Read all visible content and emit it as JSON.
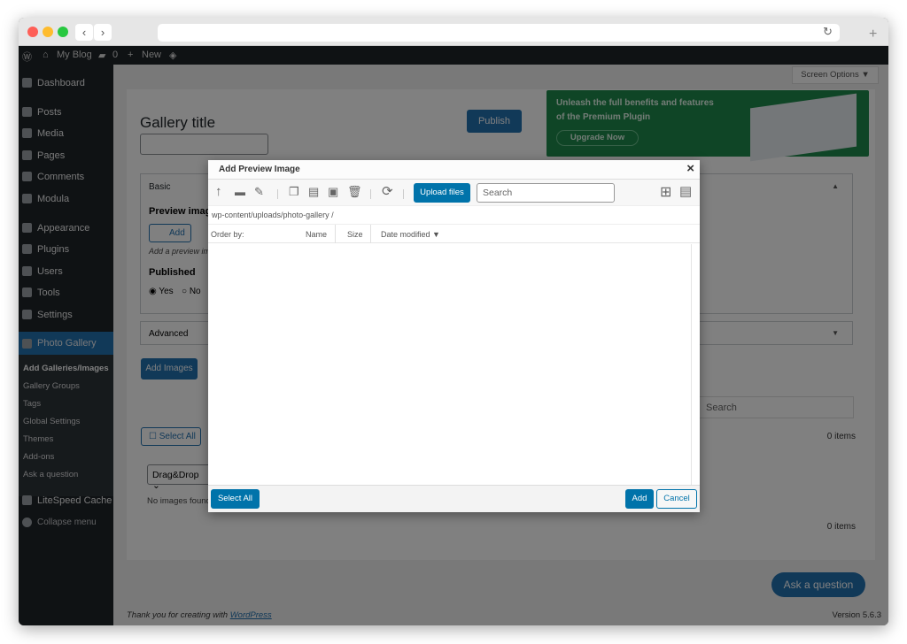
{
  "browser": {
    "back": "‹",
    "forward": "›",
    "reload": "↻",
    "new_tab": "+"
  },
  "adminbar": {
    "site": "My Blog",
    "comments": "0",
    "new": "New"
  },
  "sidebar": {
    "items": [
      {
        "label": "Dashboard"
      },
      {
        "label": "Posts"
      },
      {
        "label": "Media"
      },
      {
        "label": "Pages"
      },
      {
        "label": "Comments"
      },
      {
        "label": "Modula"
      },
      {
        "label": "Appearance"
      },
      {
        "label": "Plugins"
      },
      {
        "label": "Users"
      },
      {
        "label": "Tools"
      },
      {
        "label": "Settings"
      }
    ],
    "active": "Photo Gallery",
    "submenu": [
      "Add Galleries/Images",
      "Gallery Groups",
      "Tags",
      "Global Settings",
      "Themes",
      "Add-ons",
      "Ask a question"
    ],
    "litespeed": "LiteSpeed Cache",
    "collapse": "Collapse menu"
  },
  "page": {
    "screen_options": "Screen Options ▼",
    "gallery_title": "Gallery title",
    "publish": "Publish",
    "promo": {
      "line1": "Unleash the full benefits and features",
      "line2": "of the Premium Plugin",
      "button": "Upgrade Now"
    },
    "basic": "Basic",
    "preview_image": "Preview image",
    "add": "Add",
    "add_hint": "Add a preview image",
    "published": "Published",
    "yes": "Yes",
    "no": "No",
    "advanced": "Advanced",
    "add_images": "Add Images",
    "search_placeholder": "Search",
    "select_all": "Select All",
    "items_count": "0 items",
    "sort": "Drag&Drop",
    "no_images": "No images found.",
    "ask": "Ask a question",
    "footer": "Thank you for creating with ",
    "footer_link": "WordPress",
    "version": "Version 5.6.3"
  },
  "modal": {
    "title": "Add Preview Image",
    "close": "×",
    "upload": "Upload files",
    "search_placeholder": "Search",
    "path": "wp-content/uploads/photo-gallery /",
    "order_by": "Order by:",
    "col_name": "Name",
    "col_size": "Size",
    "col_date": "Date modified ▼",
    "select_all": "Select All",
    "add": "Add",
    "cancel": "Cancel"
  },
  "colors": {
    "accent": "#0073aa",
    "promo": "#1e8a4c",
    "sidebar": "#1d2327"
  }
}
